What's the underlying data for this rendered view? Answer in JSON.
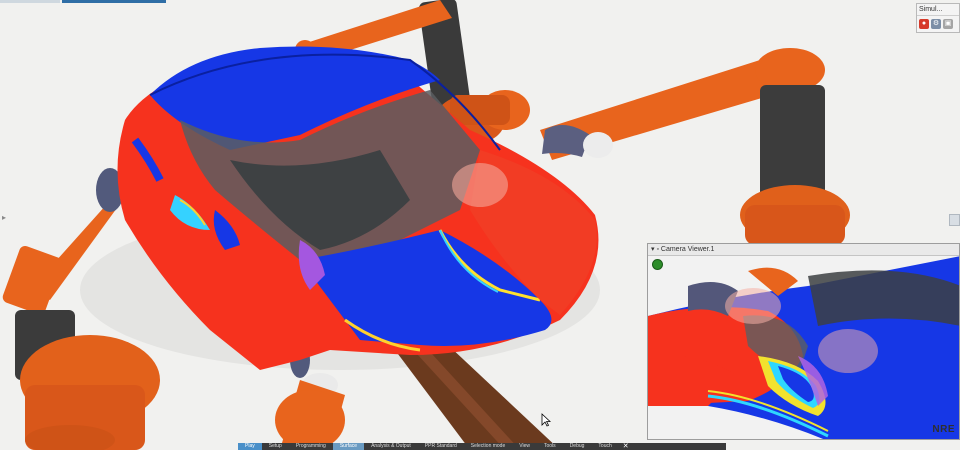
{
  "simulation_panel": {
    "title": "Simul...",
    "buttons": [
      "record-icon",
      "settings-icon",
      "window-icon"
    ]
  },
  "camera_viewer": {
    "title": "Camera Viewer.1",
    "watermark": "NRE"
  },
  "ribbon": {
    "tabs": [
      {
        "label": "Play",
        "active": true
      },
      {
        "label": "Setup"
      },
      {
        "label": "Programming"
      },
      {
        "label": "Surface"
      },
      {
        "label": "Analysis & Output"
      },
      {
        "label": "PPR Standard"
      },
      {
        "label": "Selection mode"
      },
      {
        "label": "View"
      },
      {
        "label": "Tools"
      },
      {
        "label": "Debug"
      },
      {
        "label": "Touch"
      }
    ],
    "close": "✕"
  },
  "colors": {
    "robot_orange": "#e8641d",
    "paint_red": "#f6321e",
    "paint_blue": "#1637e6",
    "ribbon_active": "#4a90c9"
  }
}
